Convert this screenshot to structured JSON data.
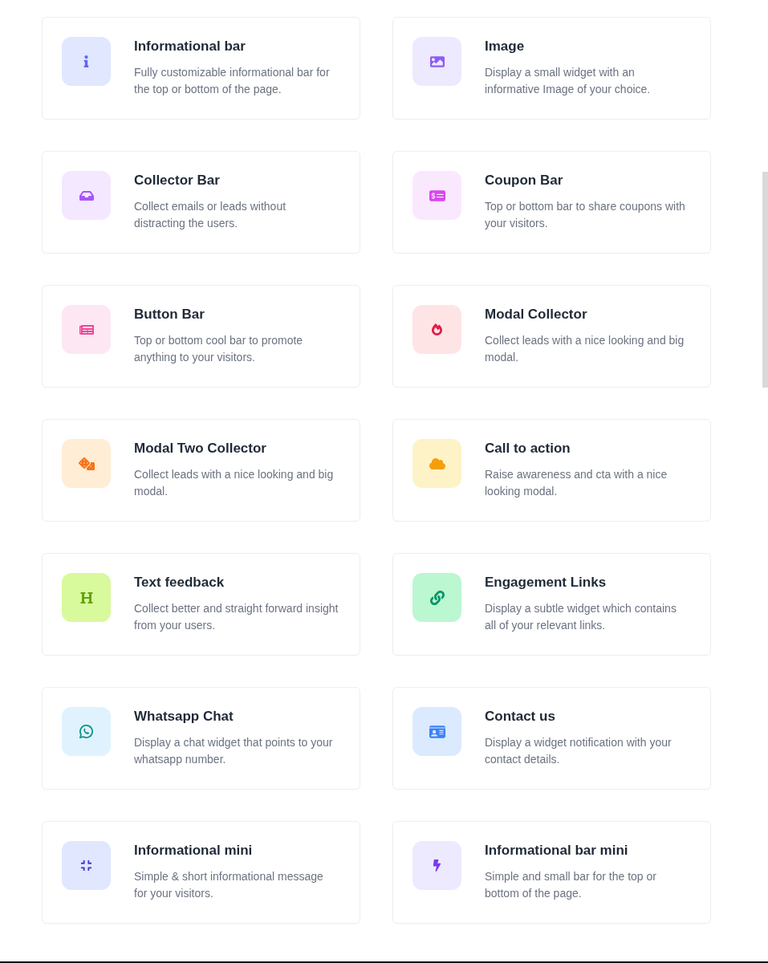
{
  "cards": [
    {
      "title": "Informational bar",
      "description": "Fully customizable informational bar for the top or bottom of the page.",
      "color": "#6366f1"
    },
    {
      "title": "Image",
      "description": "Display a small widget with an informative Image of your choice.",
      "color": "#8b5cf6"
    },
    {
      "title": "Collector Bar",
      "description": "Collect emails or leads without distracting the users.",
      "color": "#a855f7"
    },
    {
      "title": "Coupon Bar",
      "description": "Top or bottom bar to share coupons with your visitors.",
      "color": "#d946ef"
    },
    {
      "title": "Button Bar",
      "description": "Top or bottom cool bar to promote anything to your visitors.",
      "color": "#ec4899"
    },
    {
      "title": "Modal Collector",
      "description": "Collect leads with a nice looking and big modal.",
      "color": "#e11d48"
    },
    {
      "title": "Modal Two Collector",
      "description": "Collect leads with a nice looking and big modal.",
      "color": "#f97316"
    },
    {
      "title": "Call to action",
      "description": "Raise awareness and cta with a nice looking modal.",
      "color": "#f59e0b"
    },
    {
      "title": "Text feedback",
      "description": "Collect better and straight forward insight from your users.",
      "color": "#65a30d"
    },
    {
      "title": "Engagement Links",
      "description": "Display a subtle widget which contains all of your relevant links.",
      "color": "#059669"
    },
    {
      "title": "Whatsapp Chat",
      "description": "Display a chat widget that points to your whatsapp number.",
      "color": "#0d9488"
    },
    {
      "title": "Contact us",
      "description": "Display a widget notification with your contact details.",
      "color": "#3b82f6"
    },
    {
      "title": "Informational mini",
      "description": "Simple & short informational message for your visitors.",
      "color": "#4338ca"
    },
    {
      "title": "Informational bar mini",
      "description": "Simple and small bar for the top or bottom of the page.",
      "color": "#7c3aed"
    }
  ]
}
